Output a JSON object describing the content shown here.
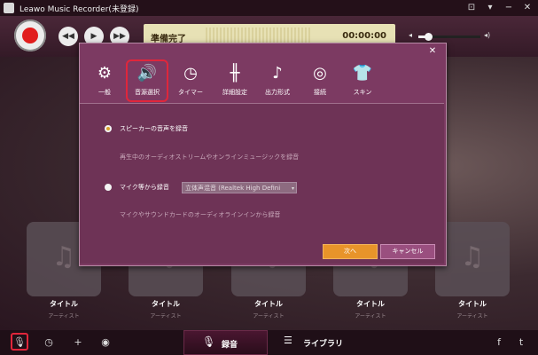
{
  "window": {
    "title": "Leawo Music Recorder(未登録)",
    "controls": [
      "⊡",
      "▾",
      "−",
      "✕"
    ]
  },
  "player": {
    "status": "準備完了",
    "time": "00:00:00",
    "volume": 0.15
  },
  "dialog": {
    "tabs": [
      {
        "label": "一般",
        "icon": "gear-icon"
      },
      {
        "label": "音源選択",
        "icon": "speaker-icon"
      },
      {
        "label": "タイマー",
        "icon": "clock-icon"
      },
      {
        "label": "詳細設定",
        "icon": "sliders-icon"
      },
      {
        "label": "出力形式",
        "icon": "music-file-icon"
      },
      {
        "label": "接続",
        "icon": "globe-icon"
      },
      {
        "label": "スキン",
        "icon": "shirt-icon"
      }
    ],
    "active_tab": "音源選択",
    "options": {
      "speaker": {
        "label": "スピーカーの音声を録音",
        "desc": "再生中のオーディオストリームやオンラインミュージックを録音",
        "selected": true
      },
      "mic": {
        "label": "マイク等から録音",
        "device": "立体声混音 (Realtek High Defini",
        "desc": "マイクやサウンドカードのオーディオラインインから録音",
        "selected": false
      }
    },
    "next_label": "次へ",
    "cancel_label": "キャンセル"
  },
  "cards": [
    {
      "title": "タイトル",
      "artist": "アーティスト"
    },
    {
      "title": "タイトル",
      "artist": "アーティスト"
    },
    {
      "title": "タイトル",
      "artist": "アーティスト"
    },
    {
      "title": "タイトル",
      "artist": "アーティスト"
    },
    {
      "title": "タイトル",
      "artist": "アーティスト"
    }
  ],
  "bottom": {
    "record_tab": "録音",
    "library_tab": "ライブラリ"
  },
  "colors": {
    "dialog_bg": "#7c3a62",
    "record_red": "#e11d1d",
    "next_button": "#e8942a",
    "highlight_red": "#e0263b"
  }
}
